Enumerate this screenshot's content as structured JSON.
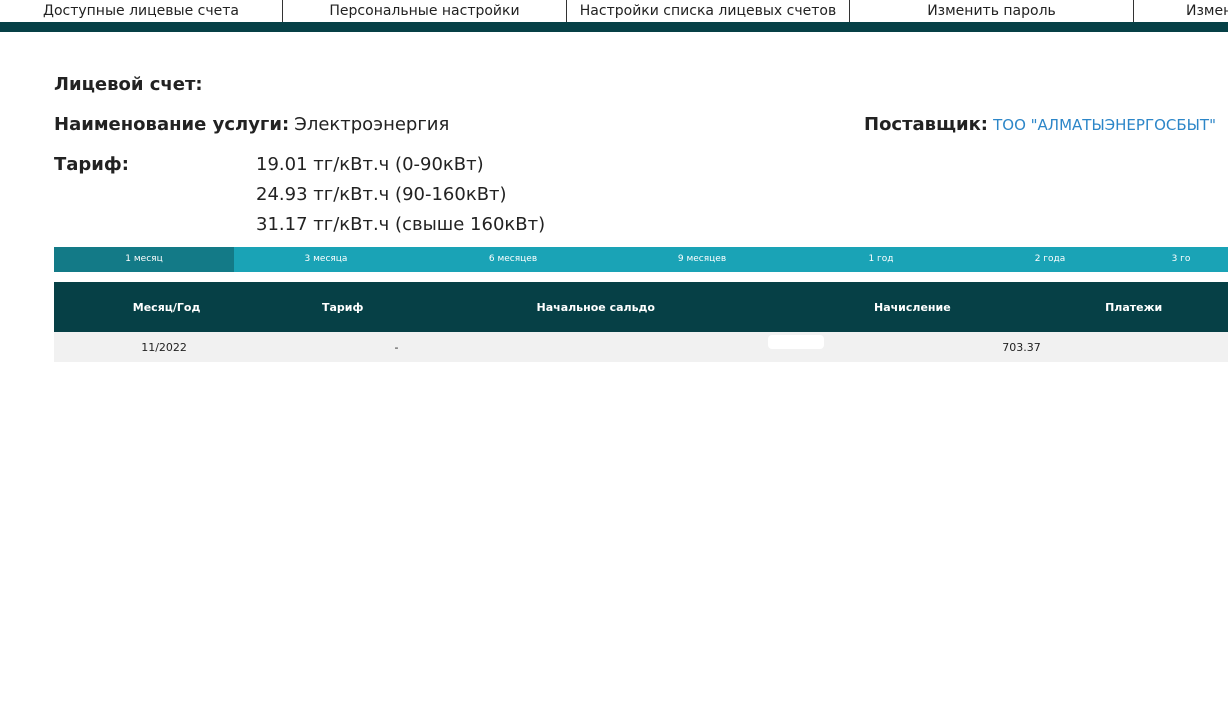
{
  "topnav": {
    "items": [
      {
        "label": "Доступные лицевые счета"
      },
      {
        "label": "Персональные настройки"
      },
      {
        "label": "Настройки списка лицевых счетов"
      },
      {
        "label": "Изменить пароль"
      },
      {
        "label": "Измен"
      }
    ]
  },
  "account": {
    "account_label": "Лицевой счет:",
    "service_label": "Наименование услуги:",
    "service_value": "Электроэнергия",
    "supplier_label": "Поставщик:",
    "supplier_value": "ТОО \"АЛМАТЫЭНЕРГОСБЫТ\"",
    "tariff_label": "Тариф:",
    "tariffs": [
      "19.01 тг/кВт.ч (0-90кВт)",
      "24.93 тг/кВт.ч (90-160кВт)",
      "31.17 тг/кВт.ч (свыше 160кВт)"
    ]
  },
  "periods": {
    "active_index": 0,
    "tabs": [
      "1 месяц",
      "3 месяца",
      "6 месяцев",
      "9 месяцев",
      "1 год",
      "2 года",
      "3 го"
    ]
  },
  "table": {
    "headers": [
      "Месяц/Год",
      "Тариф",
      "Начальное сальдо",
      "Начисление",
      "Платежи"
    ],
    "rows": [
      {
        "month": "11/2022",
        "tariff": "-",
        "opening_balance": "",
        "charge": "703.37",
        "payments": ""
      }
    ]
  },
  "colors": {
    "dark_teal": "#064046",
    "tab_bar": "#1aa3b6",
    "tab_active": "#137a87",
    "link": "#2c86c8"
  }
}
